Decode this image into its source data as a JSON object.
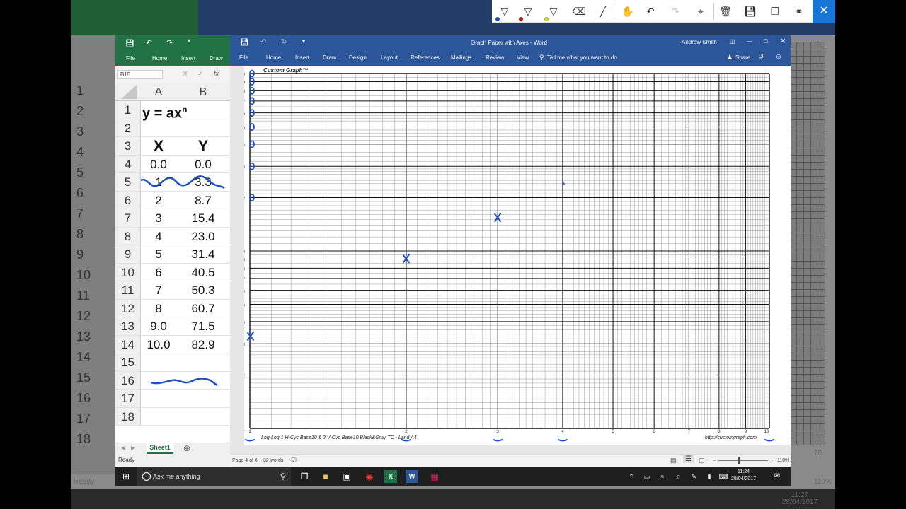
{
  "background": {
    "row_numbers": [
      "1",
      "2",
      "3",
      "4",
      "5",
      "6",
      "7",
      "8",
      "9",
      "10",
      "11",
      "12",
      "13",
      "14",
      "15",
      "16",
      "17",
      "18"
    ],
    "status": "Ready",
    "clock_time": "11:27",
    "clock_date": "28/04/2017",
    "zoom": "110%",
    "axis_label": "10"
  },
  "excel": {
    "qat": [
      "save-icon",
      "undo-icon",
      "redo-icon",
      "customize-icon"
    ],
    "tabs": [
      "File",
      "Home",
      "Insert",
      "Draw"
    ],
    "namebox": "B15",
    "fx_label": "fx",
    "columns": [
      "A",
      "B"
    ],
    "rows": [
      {
        "n": "1",
        "a": "y = ax",
        "sup": "n",
        "b": ""
      },
      {
        "n": "2",
        "a": "",
        "b": ""
      },
      {
        "n": "3",
        "a": "X",
        "b": "Y"
      },
      {
        "n": "4",
        "a": "0.0",
        "b": "0.0"
      },
      {
        "n": "5",
        "a": "1",
        "b": "3.3"
      },
      {
        "n": "6",
        "a": "2",
        "b": "8.7"
      },
      {
        "n": "7",
        "a": "3",
        "b": "15.4"
      },
      {
        "n": "8",
        "a": "4",
        "b": "23.0"
      },
      {
        "n": "9",
        "a": "5",
        "b": "31.4"
      },
      {
        "n": "10",
        "a": "6",
        "b": "40.5"
      },
      {
        "n": "11",
        "a": "7",
        "b": "50.3"
      },
      {
        "n": "12",
        "a": "8",
        "b": "60.7"
      },
      {
        "n": "13",
        "a": "9.0",
        "b": "71.5"
      },
      {
        "n": "14",
        "a": "10.0",
        "b": "82.9"
      },
      {
        "n": "15",
        "a": "",
        "b": ""
      },
      {
        "n": "16",
        "a": "",
        "b": ""
      },
      {
        "n": "17",
        "a": "",
        "b": ""
      },
      {
        "n": "18",
        "a": "",
        "b": ""
      }
    ],
    "sheet_tab": "Sheet1",
    "status": "Ready"
  },
  "word": {
    "title": "Graph Paper with Axes  -  Word",
    "user": "Andrew Smith",
    "tabs": [
      "File",
      "Home",
      "Insert",
      "Draw",
      "Design",
      "Layout",
      "References",
      "Mailings",
      "Review",
      "View"
    ],
    "tell_me": "Tell me what you want to do",
    "share": "Share",
    "page_info": "Page 4 of 6",
    "words": "32 words",
    "zoom": "110%"
  },
  "graph": {
    "brand": "Custom Graph™",
    "footer_left": "Log-Log 1 H-Cyc Base10 & 2 V-Cyc Base10 Black&Gray TC - Land A4",
    "footer_right": "http://customgraph.com",
    "x_ticks": [
      "1",
      "2",
      "3",
      "4",
      "5",
      "6",
      "7",
      "8",
      "9",
      "10"
    ],
    "y_ticks_upper": [
      "10",
      "9",
      "8",
      "7",
      "6",
      "5",
      "4",
      "3",
      "2"
    ],
    "y_ticks_lower": [
      "10",
      "9",
      "8",
      "7",
      "6",
      "5",
      "4",
      "3",
      "2",
      "1"
    ],
    "ink_color": "#1f4fbf"
  },
  "pen_toolbar": {
    "tools": [
      "pen-icon",
      "pen-icon",
      "highlighter-icon",
      "eraser-icon",
      "ruler-icon",
      "touch-writing-icon",
      "undo-icon",
      "redo-icon",
      "crop-icon",
      "delete-icon",
      "save-icon",
      "copy-icon",
      "share-icon"
    ]
  },
  "taskbar": {
    "search_placeholder": "Ask me anything",
    "time": "11:24",
    "date": "28/04/2017"
  }
}
